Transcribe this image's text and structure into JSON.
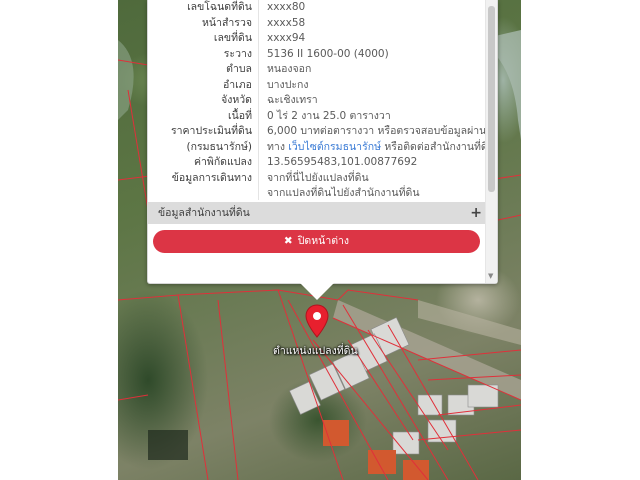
{
  "info_rows": [
    {
      "key": "เลขโฉนดที่ดิน",
      "value": "xxxx80"
    },
    {
      "key": "หน้าสำรวจ",
      "value": "xxxx58"
    },
    {
      "key": "เลขที่ดิน",
      "value": "xxxx94"
    },
    {
      "key": "ระวาง",
      "value": "5136 II 1600-00 (4000)"
    },
    {
      "key": "ตำบล",
      "value": "หนองจอก"
    },
    {
      "key": "อำเภอ",
      "value": "บางปะกง"
    },
    {
      "key": "จังหวัด",
      "value": "ฉะเชิงเทรา"
    },
    {
      "key": "เนื้อที่",
      "value": "0 ไร่ 2 งาน 25.0 ตารางวา"
    },
    {
      "key": "ราคาประเมินที่ดิน",
      "value": "6,000 บาทต่อตารางวา หรือตรวจสอบข้อมูลผ่าน"
    },
    {
      "key": "(กรมธนารักษ์)",
      "value_prefix": "ทาง ",
      "value_link": "เว็บไซต์กรมธนารักษ์",
      "value_suffix": " หรือติดต่อสำนักงานที่ดิน"
    },
    {
      "key": "ค่าพิกัดแปลง",
      "value_link": "13.56595483,101.00877692"
    },
    {
      "key": "ข้อมูลการเดินทาง",
      "value_link": "จากที่นี่ไปยังแปลงที่ดิน"
    },
    {
      "key": "",
      "value_link": "จากแปลงที่ดินไปยังสำนักงานที่ดิน"
    }
  ],
  "section": {
    "label": "ข้อมูลสำนักงานที่ดิน",
    "expand_icon": "plus-icon"
  },
  "close_button": {
    "label": "ปิดหน้าต่าง",
    "icon": "close-icon"
  },
  "map": {
    "marker_label": "ตำแหน่งแปลงที่ดิน",
    "marker_icon": "map-pin-icon"
  },
  "colors": {
    "accent_red": "#dc3545",
    "link_blue": "#3a7bd5",
    "parcel_line": "#e0303a"
  }
}
